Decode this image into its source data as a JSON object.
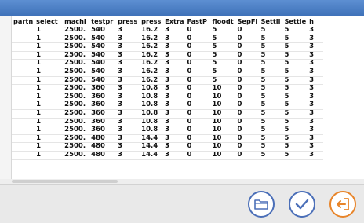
{
  "table": {
    "columns": [
      "partn",
      "select",
      "machi",
      "testpr",
      "press",
      "press",
      "Extra",
      "FastP",
      "floodt",
      "SepFl",
      "Settli",
      "Settle",
      "h"
    ],
    "rows": [
      [
        "",
        "1",
        "2500.",
        "540",
        "3",
        "16.2",
        "3",
        "0",
        "5",
        "0",
        "5",
        "5",
        "3"
      ],
      [
        "",
        "1",
        "2500.",
        "540",
        "3",
        "16.2",
        "3",
        "0",
        "5",
        "0",
        "5",
        "5",
        "3"
      ],
      [
        "",
        "1",
        "2500.",
        "540",
        "3",
        "16.2",
        "3",
        "0",
        "5",
        "0",
        "5",
        "5",
        "3"
      ],
      [
        "",
        "1",
        "2500.",
        "540",
        "3",
        "16.2",
        "3",
        "0",
        "5",
        "0",
        "5",
        "5",
        "3"
      ],
      [
        "",
        "1",
        "2500.",
        "540",
        "3",
        "16.2",
        "3",
        "0",
        "5",
        "0",
        "5",
        "5",
        "3"
      ],
      [
        "",
        "1",
        "2500.",
        "540",
        "3",
        "16.2",
        "3",
        "0",
        "5",
        "0",
        "5",
        "5",
        "3"
      ],
      [
        "",
        "1",
        "2500.",
        "540",
        "3",
        "16.2",
        "3",
        "0",
        "5",
        "0",
        "5",
        "5",
        "3"
      ],
      [
        "",
        "1",
        "2500.",
        "360",
        "3",
        "10.8",
        "3",
        "0",
        "10",
        "0",
        "5",
        "5",
        "3"
      ],
      [
        "",
        "1",
        "2500.",
        "360",
        "3",
        "10.8",
        "3",
        "0",
        "10",
        "0",
        "5",
        "5",
        "3"
      ],
      [
        "",
        "1",
        "2500.",
        "360",
        "3",
        "10.8",
        "3",
        "0",
        "10",
        "0",
        "5",
        "5",
        "3"
      ],
      [
        "",
        "1",
        "2500.",
        "360",
        "3",
        "10.8",
        "3",
        "0",
        "10",
        "0",
        "5",
        "5",
        "3"
      ],
      [
        "",
        "1",
        "2500.",
        "360",
        "3",
        "10.8",
        "3",
        "0",
        "10",
        "0",
        "5",
        "5",
        "3"
      ],
      [
        "",
        "1",
        "2500.",
        "360",
        "3",
        "10.8",
        "3",
        "0",
        "10",
        "0",
        "5",
        "5",
        "3"
      ],
      [
        "",
        "1",
        "2500.",
        "480",
        "3",
        "14.4",
        "3",
        "0",
        "10",
        "0",
        "5",
        "5",
        "3"
      ],
      [
        "",
        "1",
        "2500.",
        "480",
        "3",
        "14.4",
        "3",
        "0",
        "10",
        "0",
        "5",
        "5",
        "3"
      ],
      [
        "",
        "1",
        "2500.",
        "480",
        "3",
        "14.4",
        "3",
        "0",
        "10",
        "0",
        "5",
        "5",
        "3"
      ]
    ]
  },
  "footer": {
    "buttons": [
      {
        "name": "open-folder-button",
        "icon": "folder-icon"
      },
      {
        "name": "confirm-button",
        "icon": "checkmark-icon"
      },
      {
        "name": "exit-button",
        "icon": "exit-arrow-icon"
      }
    ]
  },
  "colors": {
    "title_bar": "#4a7fc7",
    "button_border": "#4b6fb8",
    "exit_accent": "#e8852a"
  }
}
